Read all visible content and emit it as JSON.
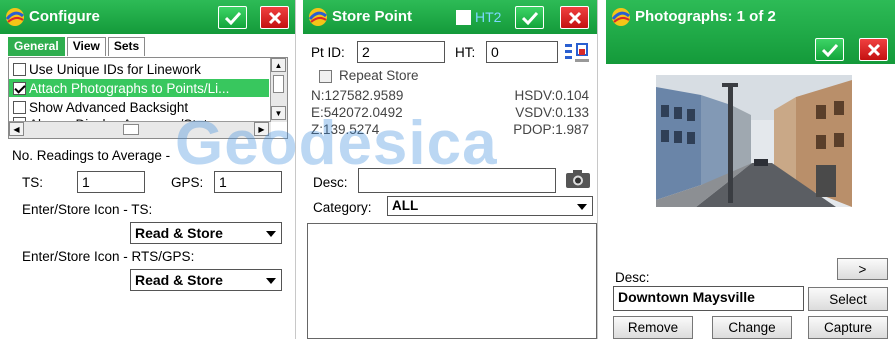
{
  "configure": {
    "title": "Configure",
    "tabs": [
      "General",
      "View",
      "Sets"
    ],
    "list_items": [
      {
        "label": "Use Unique IDs for Linework",
        "checked": false,
        "selected": false
      },
      {
        "label": "Attach Photographs to Points/Li...",
        "checked": true,
        "selected": true
      },
      {
        "label": "Show Advanced Backsight",
        "checked": false,
        "selected": false
      },
      {
        "label": "Always Display Averages/Stat...",
        "checked": false,
        "selected": false
      }
    ],
    "readings_label": "No. Readings to Average -",
    "ts_label": "TS:",
    "ts_value": "1",
    "gps_label": "GPS:",
    "gps_value": "1",
    "ts_icon_label": "Enter/Store Icon - TS:",
    "ts_icon_value": "Read & Store",
    "rts_icon_label": "Enter/Store Icon - RTS/GPS:",
    "rts_icon_value": "Read & Store"
  },
  "store_point": {
    "title": "Store Point",
    "ht2_label": "HT2",
    "pt_id_label": "Pt ID:",
    "pt_id_value": "2",
    "ht_label": "HT:",
    "ht_value": "0",
    "repeat_label": "Repeat Store",
    "north": "N:127582.9589",
    "east": "E:542072.0492",
    "z": "Z:139.5274",
    "hsdv": "HSDV:0.104",
    "vsdv": "VSDV:0.133",
    "pdop": "PDOP:1.987",
    "desc_label": "Desc:",
    "desc_value": "",
    "category_label": "Category:",
    "category_value": "ALL"
  },
  "photographs": {
    "title": "Photographs: 1 of 2",
    "desc_label": "Desc:",
    "next_label": ">",
    "desc_value": "Downtown Maysville",
    "select_label": "Select",
    "remove_label": "Remove",
    "change_label": "Change",
    "capture_label": "Capture"
  },
  "watermark": "Geodesica",
  "colors": {
    "titlebar": "#1fa847",
    "ok_button": "#19b544",
    "cancel_button": "#dc2020",
    "selection": "#38c75e",
    "watermark": "#3c8cdc"
  },
  "icons": [
    "app-logo-icon",
    "checkmark-icon",
    "close-icon",
    "grid-settings-icon",
    "camera-icon",
    "dropdown-arrow-icon"
  ]
}
